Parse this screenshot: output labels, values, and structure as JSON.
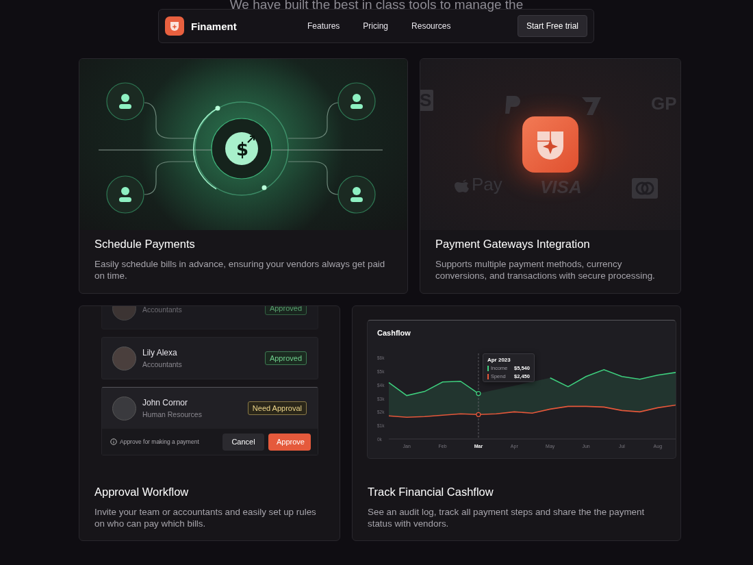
{
  "intro_text": "We have built the best in class tools to manage the",
  "nav": {
    "brand": "Finament",
    "links": [
      {
        "label": "Features"
      },
      {
        "label": "Pricing"
      },
      {
        "label": "Resources"
      }
    ],
    "cta": "Start Free trial"
  },
  "cards": [
    {
      "kind": "schedule",
      "title": "Schedule Payments",
      "description": "Easily schedule bills in advance, ensuring your vendors always get paid on time.",
      "coin_symbol": "$"
    },
    {
      "kind": "gateways",
      "title": "Payment Gateways Integration",
      "description": "Supports multiple payment methods, currency conversions, and transactions with secure processing.",
      "gateways": [
        {
          "kind": "text",
          "label": "S"
        },
        {
          "kind": "paypal"
        },
        {
          "kind": "wise"
        },
        {
          "kind": "text",
          "label": "GP"
        },
        {
          "kind": "apple",
          "label": "Pay"
        },
        {
          "kind": "text",
          "label": "VISA"
        },
        {
          "kind": "card"
        }
      ]
    },
    {
      "kind": "approval",
      "title": "Approval Workflow",
      "description": "Invite your team or accountants and easily set up rules on who can pay which bills.",
      "requests": [
        {
          "role": "Accountants",
          "approved": true,
          "badge": "Approved",
          "selected": false
        },
        {
          "name": "Lily Alexa",
          "role": "Accountants",
          "approved": true,
          "badge": "Approved",
          "selected": false
        },
        {
          "name": "John Cornor",
          "role": "Human Resources",
          "approved": false,
          "badge": "Need Approval",
          "selected": true
        }
      ],
      "footer": {
        "note": "Approve for making a payment",
        "cancel": "Cancel",
        "approve": "Approve"
      }
    },
    {
      "kind": "cashflow",
      "title": "Track Financial Cashflow",
      "description": "See an audit log, track all payment steps and share the the payment status with vendors.",
      "panel_title": "Cashflow",
      "chart_data": {
        "type": "line",
        "categories": [
          null,
          "Jan",
          null,
          "Feb",
          null,
          "Mar",
          null,
          "Apr",
          null,
          "May",
          null,
          "Jun",
          null,
          "Jul",
          null,
          "Aug",
          null
        ],
        "series": [
          {
            "name": "Income",
            "color": "#3ecf7e",
            "values": [
              4.15,
              3.2,
              3.5,
              4.2,
              4.25,
              3.35,
              null,
              null,
              null,
              4.5,
              3.85,
              4.6,
              5.1,
              4.6,
              4.4,
              4.7,
              4.9
            ]
          },
          {
            "name": "Spend",
            "color": "#e5573a",
            "values": [
              1.7,
              1.6,
              1.65,
              1.75,
              1.85,
              1.8,
              1.85,
              2.0,
              1.9,
              2.2,
              2.4,
              2.4,
              2.35,
              2.1,
              2.0,
              2.3,
              2.5
            ]
          }
        ],
        "ylim": [
          0,
          6
        ],
        "legend": "top-left",
        "annotations": [
          "Apr 2023"
        ],
        "yticks": [
          {
            "value": 0,
            "label": "0k"
          },
          {
            "value": 1,
            "label": "$1k"
          },
          {
            "value": 2,
            "label": "$2k"
          },
          {
            "value": 3,
            "label": "$3k"
          },
          {
            "value": 4,
            "label": "$4k"
          },
          {
            "value": 5,
            "label": "$5k"
          },
          {
            "value": 6,
            "label": "$6k"
          }
        ]
      },
      "tooltip": {
        "values": [
          "$5,540",
          "$2,450"
        ]
      },
      "hover_selected": [
        false,
        false,
        true,
        false,
        false,
        false,
        false,
        false
      ]
    }
  ]
}
